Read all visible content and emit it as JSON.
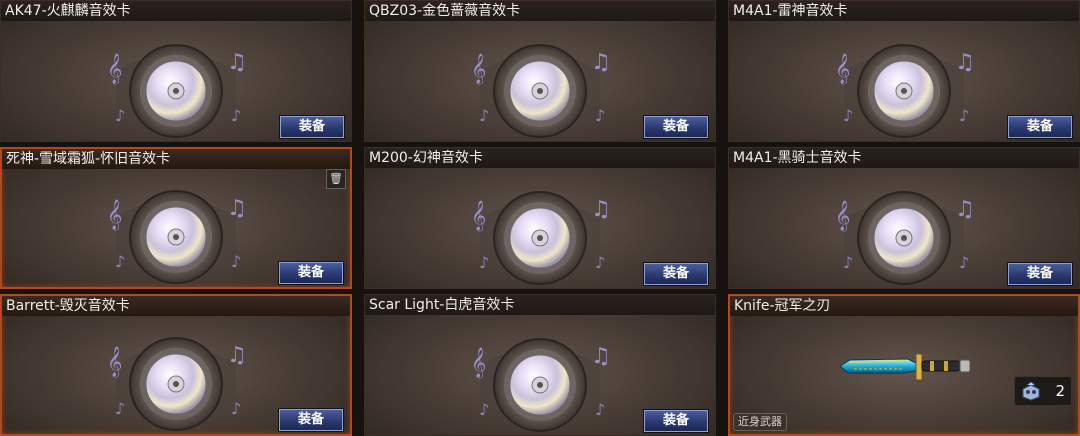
{
  "cards": [
    {
      "title": "AK47-火麒麟音效卡",
      "button": "装备"
    },
    {
      "title": "QBZ03-金色蔷薇音效卡",
      "button": "装备"
    },
    {
      "title": "M4A1-雷神音效卡",
      "button": "装备"
    },
    {
      "title": "死神-雪域霜狐-怀旧音效卡",
      "button": "装备"
    },
    {
      "title": "M200-幻神音效卡",
      "button": "装备"
    },
    {
      "title": "M4A1-黑骑士音效卡",
      "button": "装备"
    },
    {
      "title": "Barrett-毁灭音效卡",
      "button": "装备"
    },
    {
      "title": "Scar Light-白虎音效卡",
      "button": "装备"
    },
    {
      "title": "Knife-冠军之刃",
      "tag": "近身武器",
      "count": "2"
    }
  ],
  "icons": {
    "trash": "trash-icon",
    "disc": "music-disc-icon",
    "count": "box-icon"
  }
}
